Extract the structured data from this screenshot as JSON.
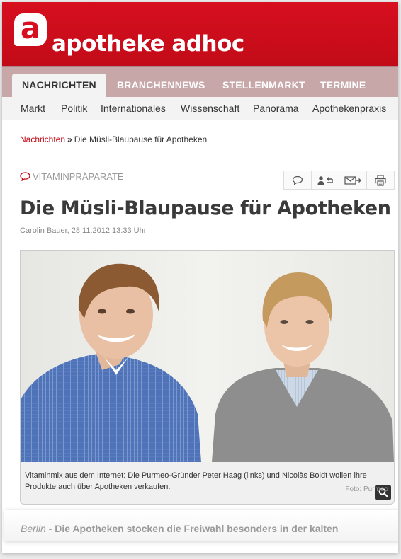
{
  "brand": {
    "logo_letter": "a",
    "name": "apotheke adhoc",
    "color": "#d70f1f"
  },
  "main_nav": {
    "tabs": [
      {
        "label": "NACHRICHTEN",
        "active": true
      },
      {
        "label": "BRANCHENNEWS",
        "active": false
      },
      {
        "label": "STELLENMARKT",
        "active": false
      },
      {
        "label": "TERMINE",
        "active": false
      }
    ]
  },
  "sub_nav": {
    "items": [
      "Markt",
      "Politik",
      "Internationales",
      "Wissenschaft",
      "Panorama",
      "Apothekenpraxis"
    ]
  },
  "breadcrumb": {
    "home": "Nachrichten",
    "separator": "»",
    "current": "Die Müsli-Blaupause für Apotheken"
  },
  "article": {
    "category": "VITAMINPRÄPARATE",
    "title": "Die Müsli-Blaupause für Apotheken",
    "byline": "Carolin Bauer, 28.11.2012 13:33 Uhr",
    "tools": [
      "comment-icon",
      "share-user-icon",
      "email-icon",
      "print-icon"
    ],
    "image": {
      "caption": "Vitaminmix aus dem Internet: Die Purmeo-Gründer Peter Haag (links) und Nicolàs Boldt wollen ihre Produkte auch über Apotheken verkaufen.",
      "credit": "Foto: Purmeo"
    },
    "teaser": {
      "city": "Berlin",
      "dash": " - ",
      "lead": "Die Apotheken stocken die Freiwahl besonders in der kalten"
    }
  }
}
